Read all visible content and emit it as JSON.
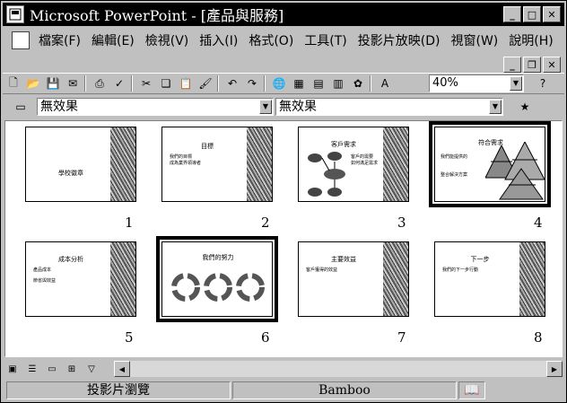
{
  "window": {
    "title": "Microsoft PowerPoint - [產品與服務]"
  },
  "menu": [
    "檔案(F)",
    "編輯(E)",
    "檢視(V)",
    "插入(I)",
    "格式(O)",
    "工具(T)",
    "投影片放映(D)",
    "視窗(W)",
    "說明(H)"
  ],
  "toolbar": {
    "zoom": "40%"
  },
  "formatting": {
    "effect_left": "無效果",
    "effect_right": "無效果"
  },
  "slides": [
    {
      "number": "1",
      "title": "學校徽章",
      "bullets": []
    },
    {
      "number": "2",
      "title": "目標",
      "bullets": [
        "我們的目標",
        "成為業界領導者"
      ]
    },
    {
      "number": "3",
      "title": "客戶需求",
      "bullets": [
        "客戶的需要",
        "如何滿足需求"
      ]
    },
    {
      "number": "4",
      "title": "符合需求",
      "bullets": [
        "我們能提供的",
        "整合解決方案"
      ]
    },
    {
      "number": "5",
      "title": "成本分析",
      "bullets": [
        "產品成本",
        "節省與效益"
      ]
    },
    {
      "number": "6",
      "title": "我們的努力",
      "bullets": []
    },
    {
      "number": "7",
      "title": "主要效益",
      "bullets": [
        "客戶獲得的效益"
      ]
    },
    {
      "number": "8",
      "title": "下一步",
      "bullets": [
        "我們的下一步行動"
      ]
    }
  ],
  "status": {
    "view": "投影片瀏覽",
    "template": "Bamboo"
  }
}
